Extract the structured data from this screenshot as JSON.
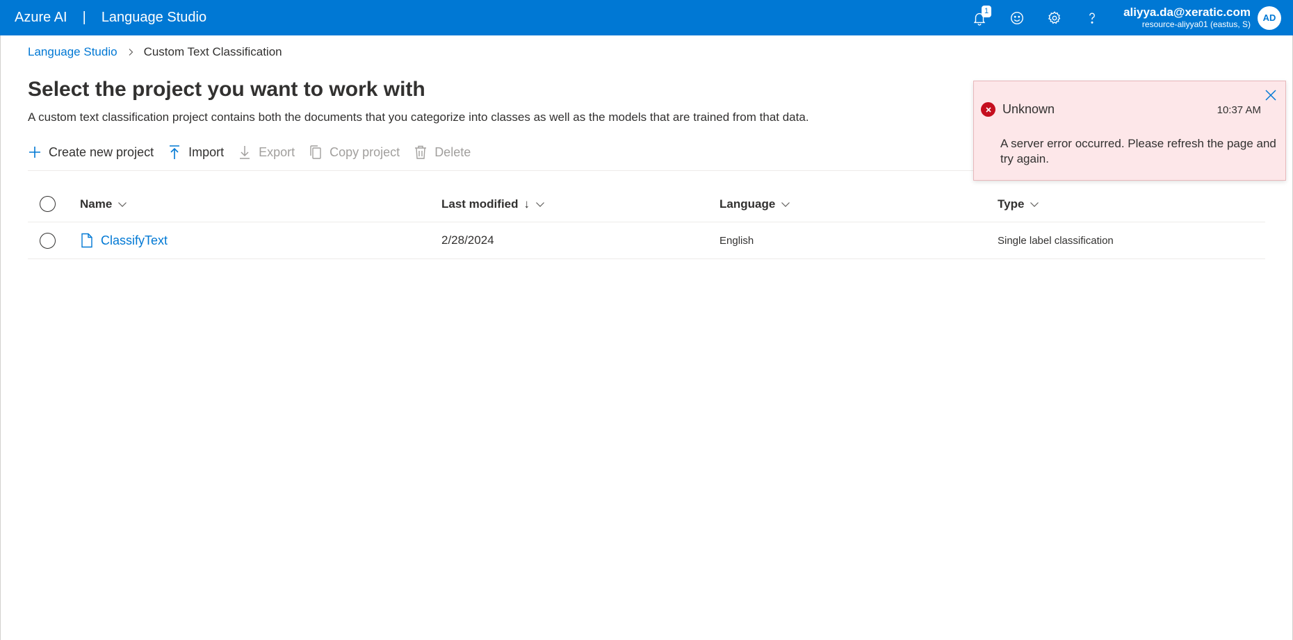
{
  "header": {
    "brand": "Azure AI",
    "separator": "|",
    "app_name": "Language Studio",
    "notification_count": "1",
    "account_email": "aliyya.da@xeratic.com",
    "account_resource": "resource-aliyya01 (eastus, S)",
    "avatar_initials": "AD",
    "icons": [
      "bell-icon",
      "smiley-icon",
      "gear-icon",
      "help-icon"
    ]
  },
  "breadcrumb": {
    "root": "Language Studio",
    "current": "Custom Text Classification"
  },
  "page": {
    "title": "Select the project you want to work with",
    "description": "A custom text classification project contains both the documents that you categorize into classes as well as the models that are trained from that data."
  },
  "commands": {
    "create": "Create new project",
    "import": "Import",
    "export": "Export",
    "copy": "Copy project",
    "delete": "Delete"
  },
  "table": {
    "columns": {
      "name": "Name",
      "last_modified": "Last modified",
      "sort_arrow": "↓",
      "language": "Language",
      "type": "Type"
    },
    "rows": [
      {
        "name": "ClassifyText",
        "last_modified": "2/28/2024",
        "language": "English",
        "type": "Single label classification"
      }
    ]
  },
  "toast": {
    "title": "Unknown",
    "time": "10:37 AM",
    "message": "A server error occurred. Please refresh the page and try again."
  },
  "colors": {
    "accent": "#0078d4",
    "error_bg": "#fde7e9",
    "error_icon": "#c50f1f",
    "disabled_text": "#a19f9d"
  }
}
